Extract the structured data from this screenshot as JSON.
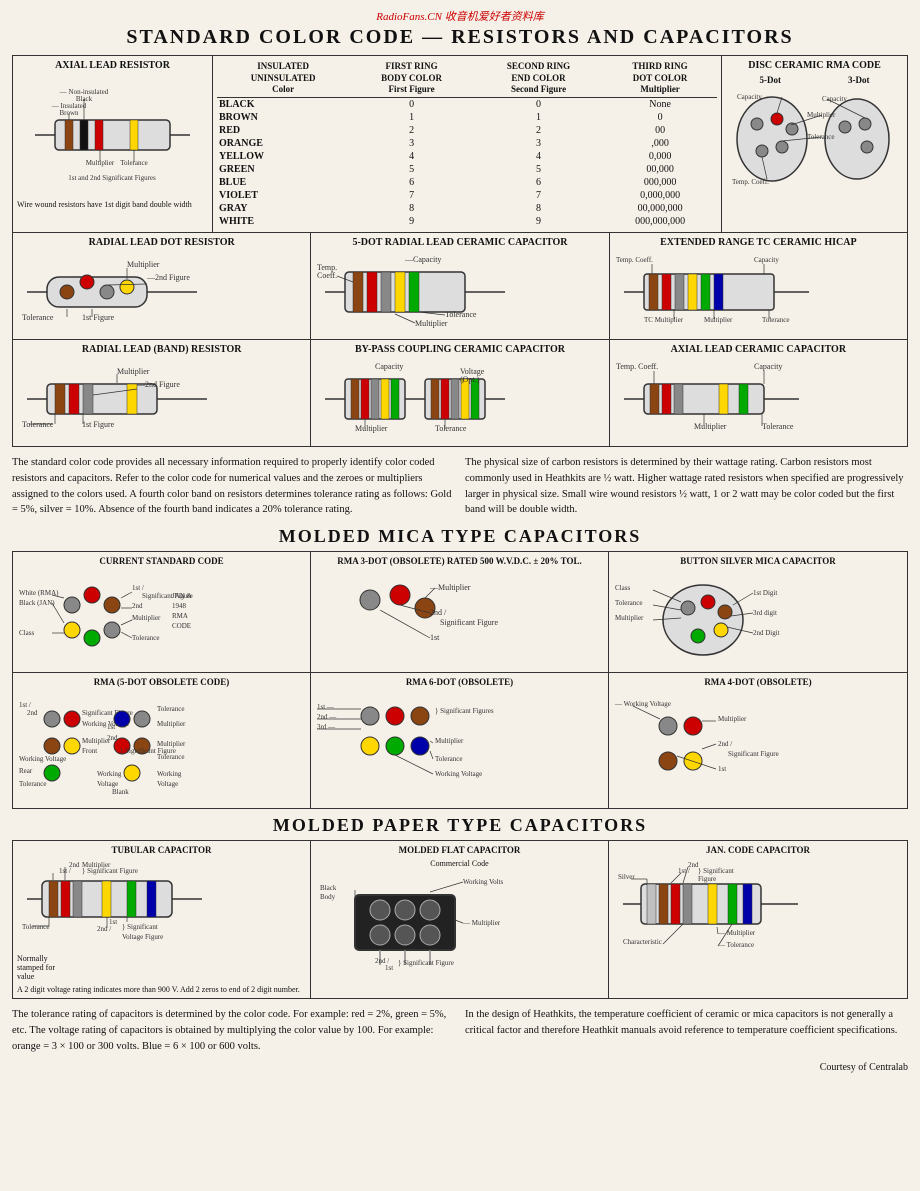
{
  "watermark": "RadioFans.CN 收音机爱好者资料库",
  "main_title": "STANDARD COLOR CODE — RESISTORS AND CAPACITORS",
  "color_table": {
    "headers": {
      "col1_line1": "INSULATED",
      "col1_line2": "UNINSULATED",
      "col1_line3": "Color",
      "col2_line1": "FIRST RING",
      "col2_line2": "BODY COLOR",
      "col2_line3": "First Figure",
      "col3_line1": "SECOND RING",
      "col3_line2": "END COLOR",
      "col3_line3": "Second Figure",
      "col4_line1": "THIRD RING",
      "col4_line2": "DOT COLOR",
      "col4_line3": "Multiplier"
    },
    "rows": [
      {
        "color": "BLACK",
        "fig1": "0",
        "fig2": "0",
        "mult": "None"
      },
      {
        "color": "BROWN",
        "fig1": "1",
        "fig2": "1",
        "mult": "0"
      },
      {
        "color": "RED",
        "fig1": "2",
        "fig2": "2",
        "mult": "00"
      },
      {
        "color": "ORANGE",
        "fig1": "3",
        "fig2": "3",
        "mult": ",000"
      },
      {
        "color": "YELLOW",
        "fig1": "4",
        "fig2": "4",
        "mult": "0,000"
      },
      {
        "color": "GREEN",
        "fig1": "5",
        "fig2": "5",
        "mult": "00,000"
      },
      {
        "color": "BLUE",
        "fig1": "6",
        "fig2": "6",
        "mult": "000,000"
      },
      {
        "color": "VIOLET",
        "fig1": "7",
        "fig2": "7",
        "mult": "0,000,000"
      },
      {
        "color": "GRAY",
        "fig1": "8",
        "fig2": "8",
        "mult": "00,000,000"
      },
      {
        "color": "WHITE",
        "fig1": "9",
        "fig2": "9",
        "mult": "000,000,000"
      }
    ]
  },
  "axial_lead": {
    "title": "AXIAL LEAD RESISTOR",
    "labels": [
      "Brown — Insulated",
      "Black — Non-insulated",
      "Tolerance",
      "Multiplier",
      "1st and 2nd Significant Figures"
    ],
    "note": "Wire wound resistors have 1st digit band double width"
  },
  "disc_ceramic": {
    "title": "DISC CERAMIC RMA CODE",
    "subtitle1": "5-Dot",
    "subtitle2": "3-Dot",
    "labels": [
      "Capacity",
      "Multiplier",
      "Tolerance",
      "Temp. Coeff."
    ]
  },
  "radial_dot": {
    "title": "RADIAL LEAD DOT RESISTOR",
    "labels": [
      "Multiplier",
      "2nd Figure",
      "Tolerance",
      "1st Figure"
    ]
  },
  "five_dot_ceramic": {
    "title": "5-DOT RADIAL LEAD CERAMIC CAPACITOR",
    "labels": [
      "Capacity",
      "Temp. Coeff.",
      "Tolerance",
      "Multiplier"
    ]
  },
  "extended_tc": {
    "title": "EXTENDED RANGE TC CERAMIC HICAP",
    "labels": [
      "Temp. Coeff.",
      "Capacity",
      "TC Multiplier",
      "Multiplier",
      "Tolerance"
    ]
  },
  "radial_band": {
    "title": "RADIAL LEAD (BAND) RESISTOR",
    "labels": [
      "Multiplier",
      "2nd Figure",
      "Tolerance",
      "1st Figure"
    ]
  },
  "bypass_coupling": {
    "title": "BY-PASS COUPLING CERAMIC CAPACITOR",
    "labels": [
      "Capacity",
      "Voltage (Opt.)",
      "Multiplier",
      "Tolerance"
    ]
  },
  "axial_ceramic": {
    "title": "AXIAL LEAD CERAMIC CAPACITOR",
    "labels": [
      "Temp. Coeff.",
      "Capacity",
      "Multiplier",
      "Tolerance"
    ]
  },
  "desc1": {
    "text": "The standard color code provides all necessary information required to properly identify color coded resistors and capacitors. Refer to the color code for numerical values and the zeroes or multipliers assigned to the colors used. A fourth color band on resistors determines tolerance rating as follows: Gold = 5%, silver = 10%. Absence of the fourth band indicates a 20% tolerance rating."
  },
  "desc2": {
    "text": "The physical size of carbon resistors is determined by their wattage rating. Carbon resistors most commonly used in Heathkits are ½ watt. Higher wattage rated resistors when specified are progressively larger in physical size. Small wire wound resistors ½ watt, 1 or 2 watt may be color coded but the first band will be double width."
  },
  "mica_title": "MOLDED MICA TYPE CAPACITORS",
  "mica_cells": [
    {
      "title": "CURRENT STANDARD CODE",
      "labels": [
        "White (RMA)",
        "Black (JAN)",
        "Class",
        "1st",
        "2nd",
        "Significant Figure",
        "Multiplier",
        "Tolerance",
        "JAN & 1948 RMA CODE"
      ]
    },
    {
      "title": "RMA 3-DOT (OBSOLETE) RATED 500 W.V.D.C. ± 20% TOL.",
      "labels": [
        "Multiplier",
        "2nd",
        "1st",
        "Significant Figure"
      ]
    },
    {
      "title": "BUTTON SILVER MICA CAPACITOR",
      "labels": [
        "Class",
        "Tolerance",
        "Multiplier",
        "1st Digit",
        "3rd digit",
        "2nd Digit"
      ]
    },
    {
      "title": "RMA (5-DOT OBSOLETE CODE)",
      "labels": [
        "1st",
        "2nd",
        "Significant Figure",
        "Working Voltage",
        "Multiplier",
        "Front",
        "Working Voltage",
        "Rear",
        "Tolerance",
        "1st",
        "2nd",
        "Significant Figure",
        "Multiplier",
        "Tolerance",
        "Working Voltage",
        "Blank",
        "Tolerance",
        "Working Voltage"
      ]
    },
    {
      "title": "RMA 6-DOT (OBSOLETE)",
      "labels": [
        "1st",
        "2nd",
        "3rd",
        "Significant Figures",
        "Multiplier",
        "Tolerance",
        "Working Voltage"
      ]
    },
    {
      "title": "RMA 4-DOT (OBSOLETE)",
      "labels": [
        "Working Voltage",
        "Multiplier",
        "2nd",
        "1st",
        "Significant Figure"
      ]
    }
  ],
  "paper_title": "MOLDED PAPER TYPE CAPACITORS",
  "paper_cells": [
    {
      "title": "TUBULAR CAPACITOR",
      "labels": [
        "1st",
        "2nd",
        "Significant Figure",
        "Multiplier",
        "Tolerance",
        "2nd",
        "1st",
        "Significant Voltage Figure"
      ],
      "note_title": "Normally stamped for value",
      "note2": "A 2 digit voltage rating indicates more than 900 V. Add 2 zeros to end of 2 digit number."
    },
    {
      "title": "MOLDED FLAT CAPACITOR",
      "subtitle": "Commercial Code",
      "labels": [
        "Black Body",
        "Working Volts",
        "Multiplier",
        "2nd",
        "1st",
        "Significant Figure"
      ]
    },
    {
      "title": "JAN. CODE CAPACITOR",
      "labels": [
        "Silver",
        "1st",
        "2nd",
        "Significant Figure",
        "Multiplier",
        "Tolerance",
        "Characteristic"
      ]
    }
  ],
  "bottom_desc1": {
    "text": "The tolerance rating of capacitors is determined by the color code. For example: red = 2%, green = 5%, etc. The voltage rating of capacitors is obtained by multiplying the color value by 100. For example: orange = 3 × 100 or 300 volts. Blue = 6 × 100 or 600 volts."
  },
  "bottom_desc2": {
    "text": "In the design of Heathkits, the temperature coefficient of ceramic or mica capacitors is not generally a critical factor and therefore Heathkit manuals avoid reference to temperature coefficient specifications."
  },
  "courtesy": "Courtesy of Centralab"
}
